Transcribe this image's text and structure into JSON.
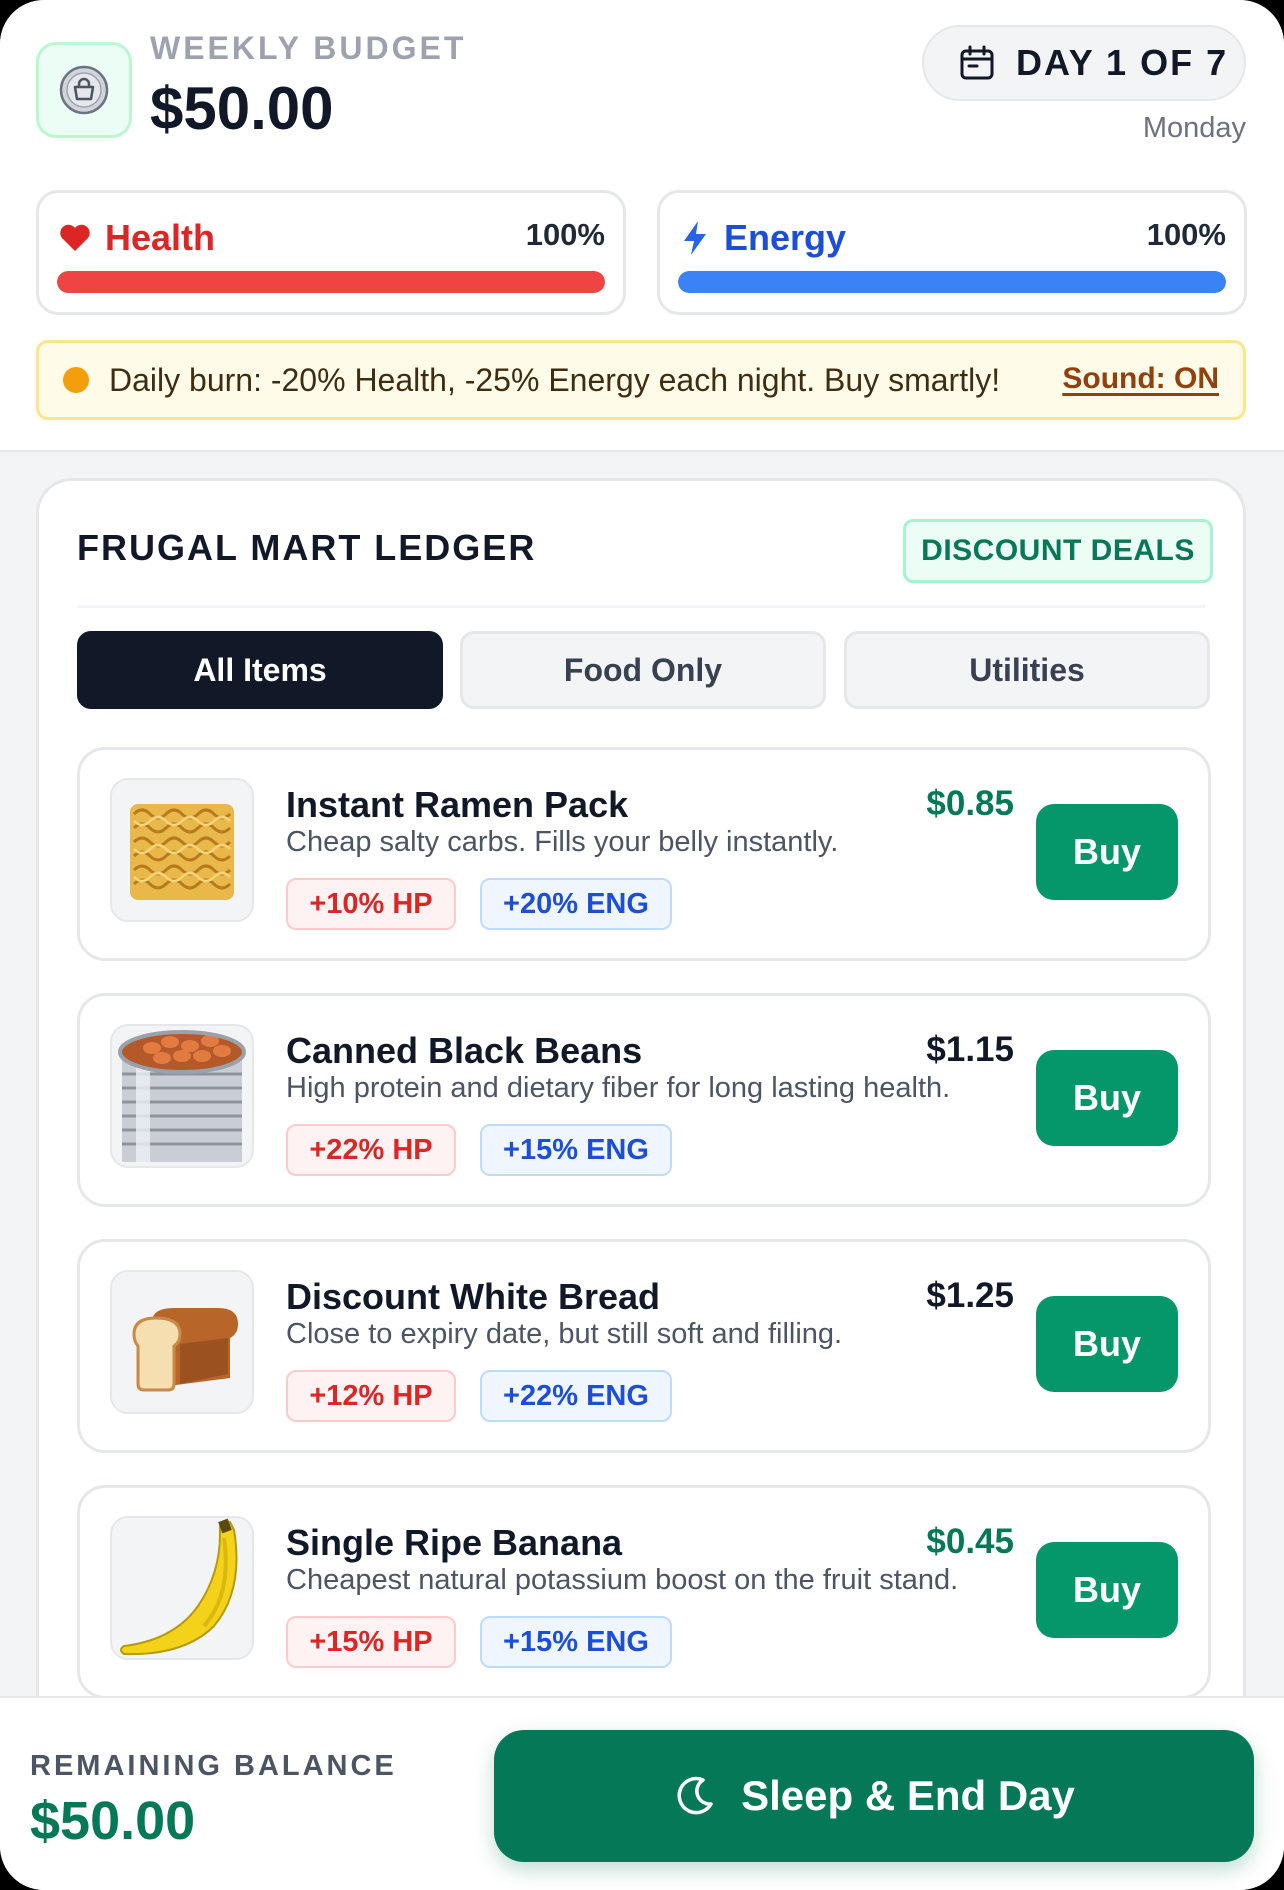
{
  "header": {
    "budget_label": "WEEKLY BUDGET",
    "budget_value": "$50.00",
    "day_label": "DAY 1 OF 7",
    "weekday": "Monday",
    "wallet_icon": "shopping-bag-icon",
    "calendar_icon": "calendar-icon"
  },
  "stats": {
    "health": {
      "label": "Health",
      "value": "100%",
      "level": 1.0,
      "color": "#ef4444",
      "icon": "heart-icon"
    },
    "energy": {
      "label": "Energy",
      "value": "100%",
      "level": 1.0,
      "color": "#3b82f6",
      "icon": "lightning-icon"
    }
  },
  "notice": {
    "text": "Daily burn: -20% Health, -25% Energy each night. Buy smartly!",
    "sound_label": "Sound: ON"
  },
  "ledger": {
    "title": "FRUGAL MART LEDGER",
    "deals_badge": "DISCOUNT DEALS",
    "tabs": [
      {
        "label": "All Items",
        "active": true
      },
      {
        "label": "Food Only",
        "active": false
      },
      {
        "label": "Utilities",
        "active": false
      }
    ],
    "items": [
      {
        "name": "Instant Ramen Pack",
        "desc": "Cheap salty carbs. Fills your belly instantly.",
        "price": "$0.85",
        "price_color": "#047857",
        "hp": "+10% HP",
        "eng": "+20% ENG",
        "buy": "Buy",
        "image": "ramen-image"
      },
      {
        "name": "Canned Black Beans",
        "desc": "High protein and dietary fiber for long lasting health.",
        "price": "$1.15",
        "price_color": "#111827",
        "hp": "+22% HP",
        "eng": "+15% ENG",
        "buy": "Buy",
        "image": "canned-beans-image"
      },
      {
        "name": "Discount White Bread",
        "desc": "Close to expiry date, but still soft and filling.",
        "price": "$1.25",
        "price_color": "#111827",
        "hp": "+12% HP",
        "eng": "+22% ENG",
        "buy": "Buy",
        "image": "bread-image"
      },
      {
        "name": "Single Ripe Banana",
        "desc": "Cheapest natural potassium boost on the fruit stand.",
        "price": "$0.45",
        "price_color": "#047857",
        "hp": "+15% HP",
        "eng": "+15% ENG",
        "buy": "Buy",
        "image": "banana-image"
      }
    ]
  },
  "footer": {
    "remaining_label": "REMAINING BALANCE",
    "remaining_value": "$50.00",
    "sleep_label": "Sleep & End Day",
    "sleep_icon": "moon-icon"
  }
}
